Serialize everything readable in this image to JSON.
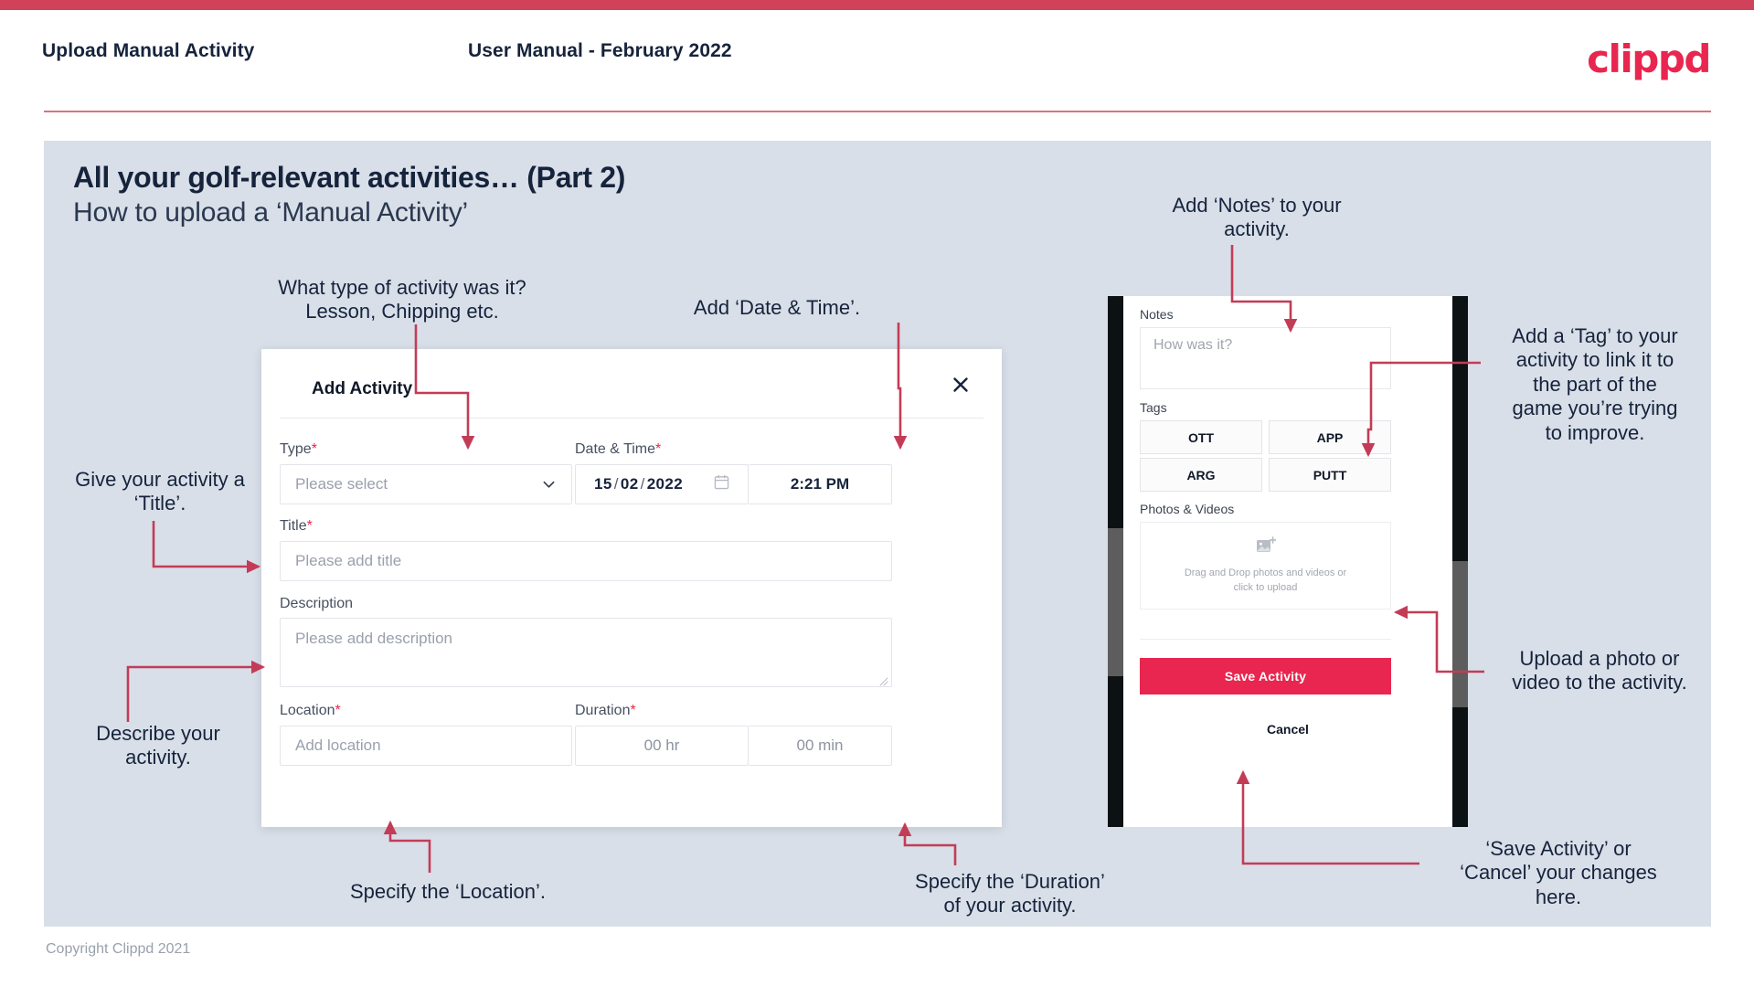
{
  "header": {
    "left_title": "Upload Manual Activity",
    "center_title": "User Manual - February 2022",
    "logo": "clippd"
  },
  "slide": {
    "title_main": "All your golf-relevant activities… (Part 2)",
    "title_sub": "How to upload a ‘Manual Activity’"
  },
  "annotations": {
    "type": "What type of activity was it?\nLesson, Chipping etc.",
    "date_time": "Add ‘Date & Time’.",
    "title": "Give your activity a\n‘Title’.",
    "description": "Describe your\nactivity.",
    "location": "Specify the ‘Location’.",
    "duration": "Specify the ‘Duration’\nof your activity.",
    "notes": "Add ‘Notes’ to your\nactivity.",
    "tags": "Add a ‘Tag’ to your\nactivity to link it to\nthe part of the\ngame you’re trying\nto improve.",
    "photos": "Upload a photo or\nvideo to the activity.",
    "save_cancel": "‘Save Activity’ or\n‘Cancel’ your changes\nhere."
  },
  "modal": {
    "title": "Add Activity",
    "close_icon": "close-icon",
    "fields": {
      "type": {
        "label": "Type",
        "required": "*",
        "placeholder": "Please select",
        "chevron_icon": "chevron-down-icon"
      },
      "datetime": {
        "label": "Date & Time",
        "required": "*",
        "day": "15",
        "month": "02",
        "year": "2022",
        "separator": "/",
        "calendar_icon": "calendar-icon",
        "time": "2:21 PM"
      },
      "title": {
        "label": "Title",
        "required": "*",
        "placeholder": "Please add title"
      },
      "description": {
        "label": "Description",
        "required": "",
        "placeholder": "Please add description"
      },
      "location": {
        "label": "Location",
        "required": "*",
        "placeholder": "Add location"
      },
      "duration": {
        "label": "Duration",
        "required": "*",
        "hours_placeholder": "00 hr",
        "minutes_placeholder": "00 min"
      }
    }
  },
  "phone": {
    "notes": {
      "label": "Notes",
      "placeholder": "How was it?"
    },
    "tags": {
      "label": "Tags",
      "items": [
        "OTT",
        "APP",
        "ARG",
        "PUTT"
      ]
    },
    "photos": {
      "label": "Photos & Videos",
      "upload_icon": "add-image-icon",
      "drop_text_line1": "Drag and Drop photos and videos or",
      "drop_text_line2": "click to upload"
    },
    "save_label": "Save Activity",
    "cancel_label": "Cancel"
  },
  "footer": {
    "copyright": "Copyright Clippd 2021"
  },
  "colors": {
    "brand_pink": "#e8264f",
    "top_bar": "#cf4259",
    "slide_bg": "#d8dfe8",
    "text_dark": "#16233c",
    "arrow": "#c33c57"
  }
}
